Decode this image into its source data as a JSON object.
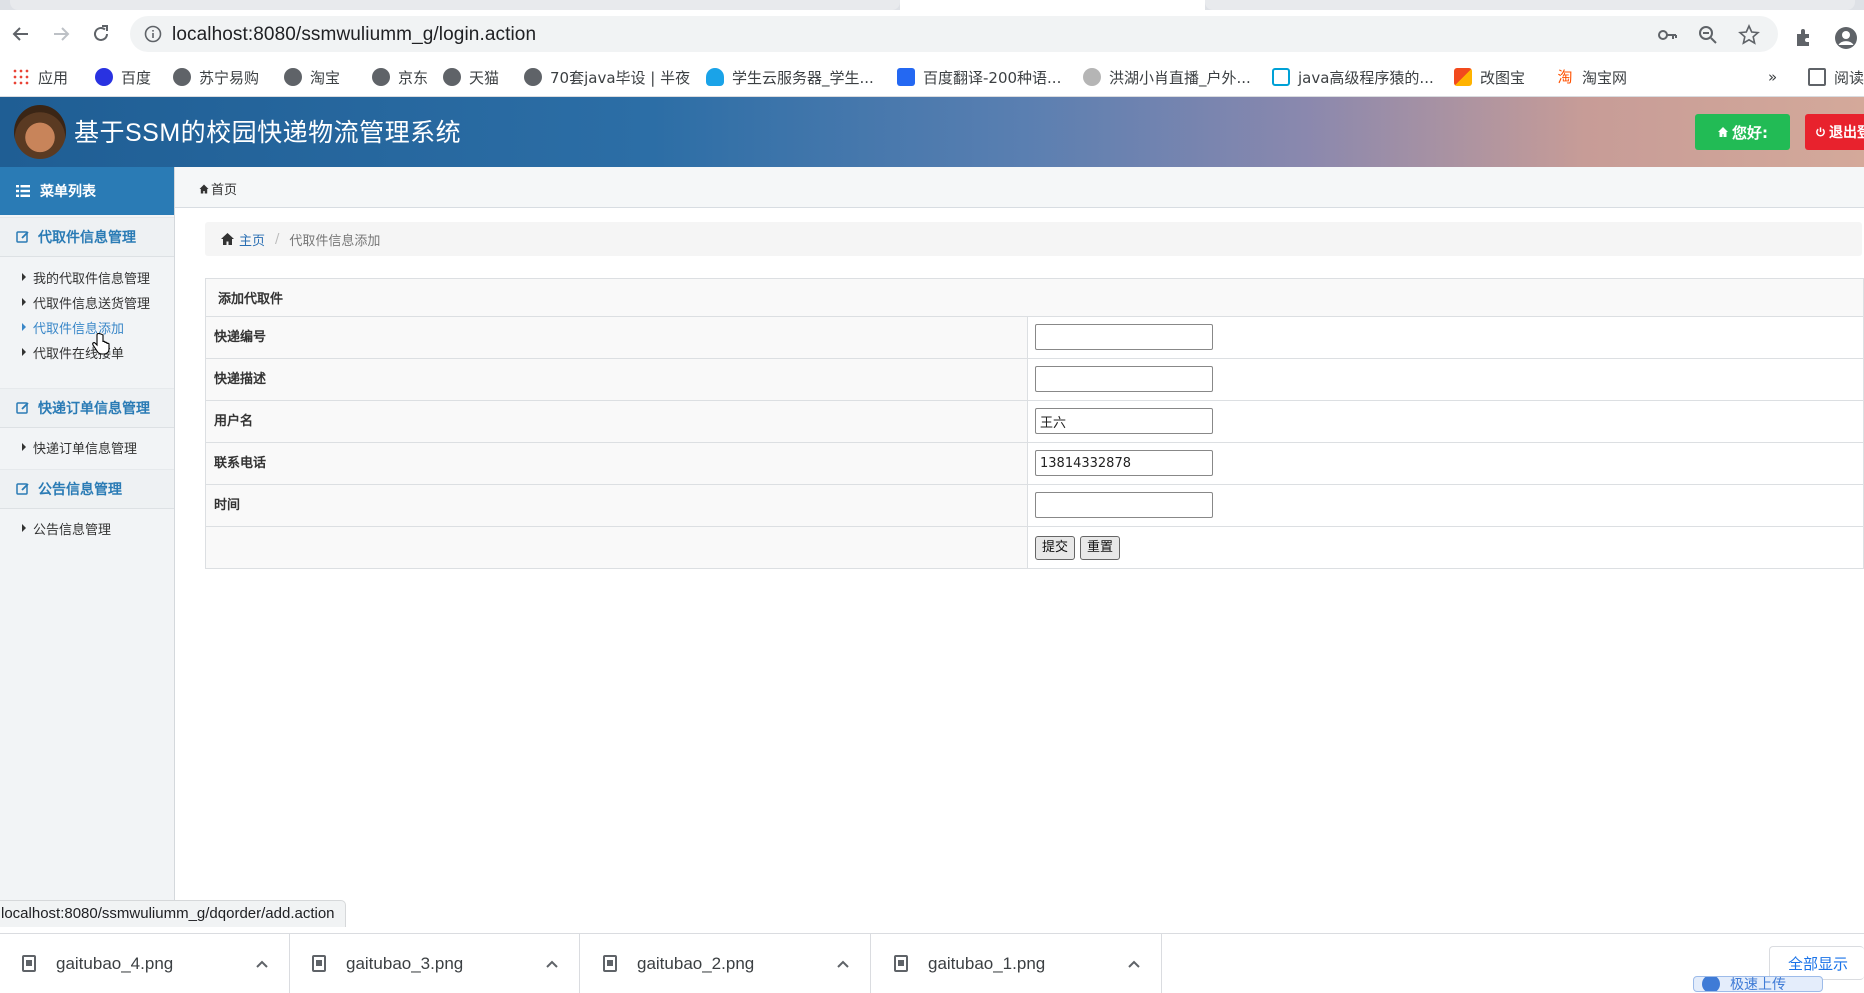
{
  "browser": {
    "url": "localhost:8080/ssmwuliumm_g/login.action",
    "status_url": "localhost:8080/ssmwuliumm_g/dqorder/add.action",
    "bookmarks": [
      {
        "label": "应用",
        "icon": "apps-grid-icon",
        "color": "#1a73e8"
      },
      {
        "label": "百度",
        "icon": "baidu-paw-icon",
        "color": "#2932e1"
      },
      {
        "label": "苏宁易购",
        "icon": "globe-icon",
        "color": "#5f6368"
      },
      {
        "label": "淘宝",
        "icon": "globe-icon",
        "color": "#5f6368"
      },
      {
        "label": "京东",
        "icon": "globe-icon",
        "color": "#5f6368"
      },
      {
        "label": "天猫",
        "icon": "globe-icon",
        "color": "#5f6368"
      },
      {
        "label": "70套java毕设 | 半夜",
        "icon": "globe-icon",
        "color": "#5f6368"
      },
      {
        "label": "学生云服务器_学生...",
        "icon": "cloud-icon",
        "color": "#1aa3e8"
      },
      {
        "label": "百度翻译-200种语...",
        "icon": "translate-icon",
        "color": "#2468f2"
      },
      {
        "label": "洪湖小肖直播_户外...",
        "icon": "bird-icon",
        "color": "#888888"
      },
      {
        "label": "java高级程序猿的...",
        "icon": "bilibili-icon",
        "color": "#00a1d6"
      },
      {
        "label": "改图宝",
        "icon": "gaitubao-icon",
        "color": "#f24a1d"
      },
      {
        "label": "淘宝网",
        "icon": "taobao-icon",
        "color": "#ff5000"
      },
      {
        "label": "阅读",
        "icon": "reading-list-icon",
        "color": "#5f6368"
      }
    ],
    "more_bookmarks": "»"
  },
  "app": {
    "title": "基于SSM的校园快递物流管理系统",
    "hello_label": "您好:",
    "logout_label": "退出登录",
    "colors": {
      "primary": "#2a7bb5",
      "hello": "#22bb55",
      "logout": "#e8222d"
    }
  },
  "sidebar": {
    "menu_title": "菜单列表",
    "groups": [
      {
        "label": "代取件信息管理",
        "items": [
          "我的代取件信息管理",
          "代取件信息送货管理",
          "代取件信息添加",
          "代取件在线接单"
        ]
      },
      {
        "label": "快递订单信息管理",
        "items": [
          "快递订单信息管理"
        ]
      },
      {
        "label": "公告信息管理",
        "items": [
          "公告信息管理"
        ]
      }
    ],
    "active_item": "代取件信息添加"
  },
  "main": {
    "subnav_home": "首页",
    "breadcrumb": {
      "home": "主页",
      "separator": "/",
      "current": "代取件信息添加"
    },
    "form": {
      "title": "添加代取件",
      "fields": [
        {
          "label": "快递编号",
          "value": ""
        },
        {
          "label": "快递描述",
          "value": ""
        },
        {
          "label": "用户名",
          "value": "王六"
        },
        {
          "label": "联系电话",
          "value": "13814332878"
        },
        {
          "label": "时间",
          "value": ""
        }
      ],
      "submit_label": "提交",
      "reset_label": "重置"
    }
  },
  "downloads": {
    "files": [
      "gaitubao_4.png",
      "gaitubao_3.png",
      "gaitubao_2.png",
      "gaitubao_1.png"
    ],
    "show_all": "全部显示",
    "fast_upload": "极速上传"
  }
}
